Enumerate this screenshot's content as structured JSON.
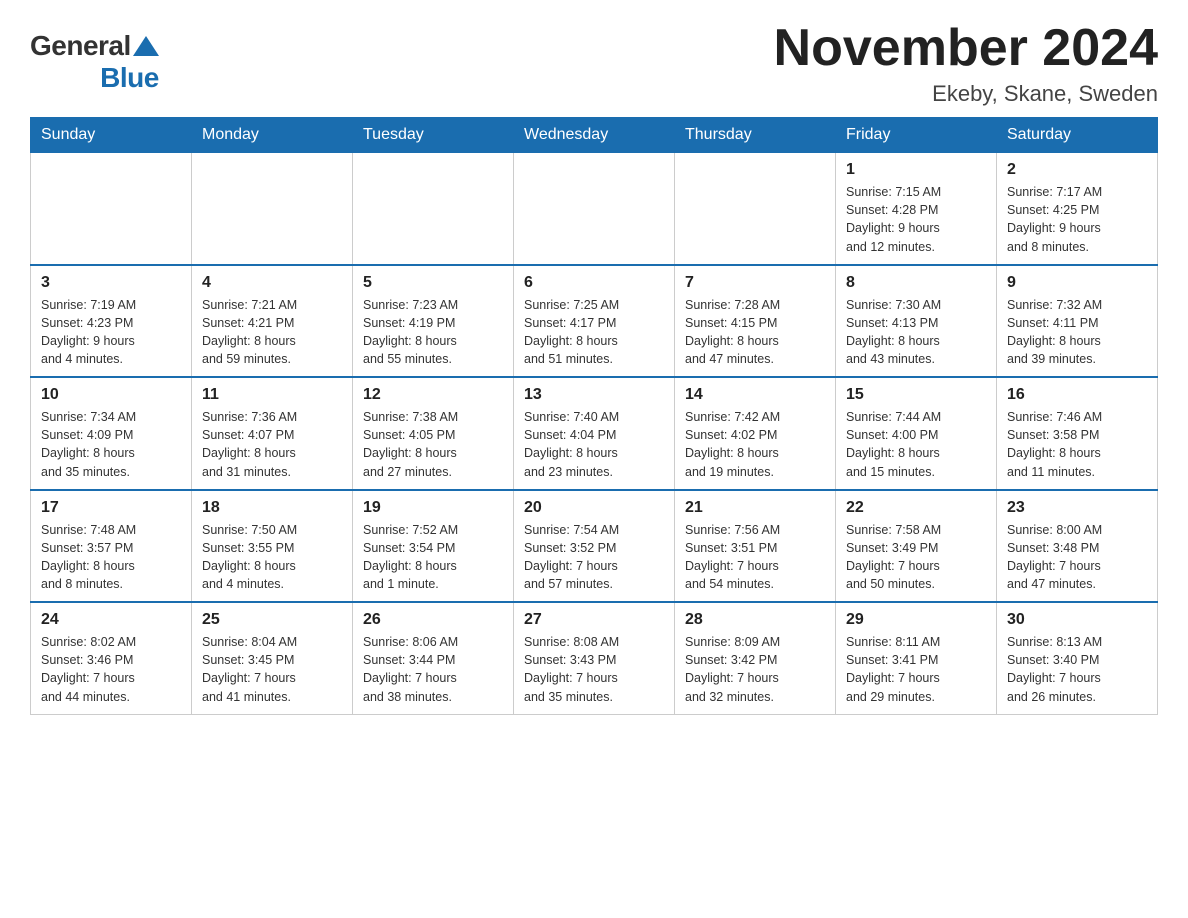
{
  "logo": {
    "general": "General",
    "blue": "Blue"
  },
  "title": "November 2024",
  "location": "Ekeby, Skane, Sweden",
  "days_of_week": [
    "Sunday",
    "Monday",
    "Tuesday",
    "Wednesday",
    "Thursday",
    "Friday",
    "Saturday"
  ],
  "weeks": [
    [
      {
        "day": "",
        "info": ""
      },
      {
        "day": "",
        "info": ""
      },
      {
        "day": "",
        "info": ""
      },
      {
        "day": "",
        "info": ""
      },
      {
        "day": "",
        "info": ""
      },
      {
        "day": "1",
        "info": "Sunrise: 7:15 AM\nSunset: 4:28 PM\nDaylight: 9 hours\nand 12 minutes."
      },
      {
        "day": "2",
        "info": "Sunrise: 7:17 AM\nSunset: 4:25 PM\nDaylight: 9 hours\nand 8 minutes."
      }
    ],
    [
      {
        "day": "3",
        "info": "Sunrise: 7:19 AM\nSunset: 4:23 PM\nDaylight: 9 hours\nand 4 minutes."
      },
      {
        "day": "4",
        "info": "Sunrise: 7:21 AM\nSunset: 4:21 PM\nDaylight: 8 hours\nand 59 minutes."
      },
      {
        "day": "5",
        "info": "Sunrise: 7:23 AM\nSunset: 4:19 PM\nDaylight: 8 hours\nand 55 minutes."
      },
      {
        "day": "6",
        "info": "Sunrise: 7:25 AM\nSunset: 4:17 PM\nDaylight: 8 hours\nand 51 minutes."
      },
      {
        "day": "7",
        "info": "Sunrise: 7:28 AM\nSunset: 4:15 PM\nDaylight: 8 hours\nand 47 minutes."
      },
      {
        "day": "8",
        "info": "Sunrise: 7:30 AM\nSunset: 4:13 PM\nDaylight: 8 hours\nand 43 minutes."
      },
      {
        "day": "9",
        "info": "Sunrise: 7:32 AM\nSunset: 4:11 PM\nDaylight: 8 hours\nand 39 minutes."
      }
    ],
    [
      {
        "day": "10",
        "info": "Sunrise: 7:34 AM\nSunset: 4:09 PM\nDaylight: 8 hours\nand 35 minutes."
      },
      {
        "day": "11",
        "info": "Sunrise: 7:36 AM\nSunset: 4:07 PM\nDaylight: 8 hours\nand 31 minutes."
      },
      {
        "day": "12",
        "info": "Sunrise: 7:38 AM\nSunset: 4:05 PM\nDaylight: 8 hours\nand 27 minutes."
      },
      {
        "day": "13",
        "info": "Sunrise: 7:40 AM\nSunset: 4:04 PM\nDaylight: 8 hours\nand 23 minutes."
      },
      {
        "day": "14",
        "info": "Sunrise: 7:42 AM\nSunset: 4:02 PM\nDaylight: 8 hours\nand 19 minutes."
      },
      {
        "day": "15",
        "info": "Sunrise: 7:44 AM\nSunset: 4:00 PM\nDaylight: 8 hours\nand 15 minutes."
      },
      {
        "day": "16",
        "info": "Sunrise: 7:46 AM\nSunset: 3:58 PM\nDaylight: 8 hours\nand 11 minutes."
      }
    ],
    [
      {
        "day": "17",
        "info": "Sunrise: 7:48 AM\nSunset: 3:57 PM\nDaylight: 8 hours\nand 8 minutes."
      },
      {
        "day": "18",
        "info": "Sunrise: 7:50 AM\nSunset: 3:55 PM\nDaylight: 8 hours\nand 4 minutes."
      },
      {
        "day": "19",
        "info": "Sunrise: 7:52 AM\nSunset: 3:54 PM\nDaylight: 8 hours\nand 1 minute."
      },
      {
        "day": "20",
        "info": "Sunrise: 7:54 AM\nSunset: 3:52 PM\nDaylight: 7 hours\nand 57 minutes."
      },
      {
        "day": "21",
        "info": "Sunrise: 7:56 AM\nSunset: 3:51 PM\nDaylight: 7 hours\nand 54 minutes."
      },
      {
        "day": "22",
        "info": "Sunrise: 7:58 AM\nSunset: 3:49 PM\nDaylight: 7 hours\nand 50 minutes."
      },
      {
        "day": "23",
        "info": "Sunrise: 8:00 AM\nSunset: 3:48 PM\nDaylight: 7 hours\nand 47 minutes."
      }
    ],
    [
      {
        "day": "24",
        "info": "Sunrise: 8:02 AM\nSunset: 3:46 PM\nDaylight: 7 hours\nand 44 minutes."
      },
      {
        "day": "25",
        "info": "Sunrise: 8:04 AM\nSunset: 3:45 PM\nDaylight: 7 hours\nand 41 minutes."
      },
      {
        "day": "26",
        "info": "Sunrise: 8:06 AM\nSunset: 3:44 PM\nDaylight: 7 hours\nand 38 minutes."
      },
      {
        "day": "27",
        "info": "Sunrise: 8:08 AM\nSunset: 3:43 PM\nDaylight: 7 hours\nand 35 minutes."
      },
      {
        "day": "28",
        "info": "Sunrise: 8:09 AM\nSunset: 3:42 PM\nDaylight: 7 hours\nand 32 minutes."
      },
      {
        "day": "29",
        "info": "Sunrise: 8:11 AM\nSunset: 3:41 PM\nDaylight: 7 hours\nand 29 minutes."
      },
      {
        "day": "30",
        "info": "Sunrise: 8:13 AM\nSunset: 3:40 PM\nDaylight: 7 hours\nand 26 minutes."
      }
    ]
  ]
}
